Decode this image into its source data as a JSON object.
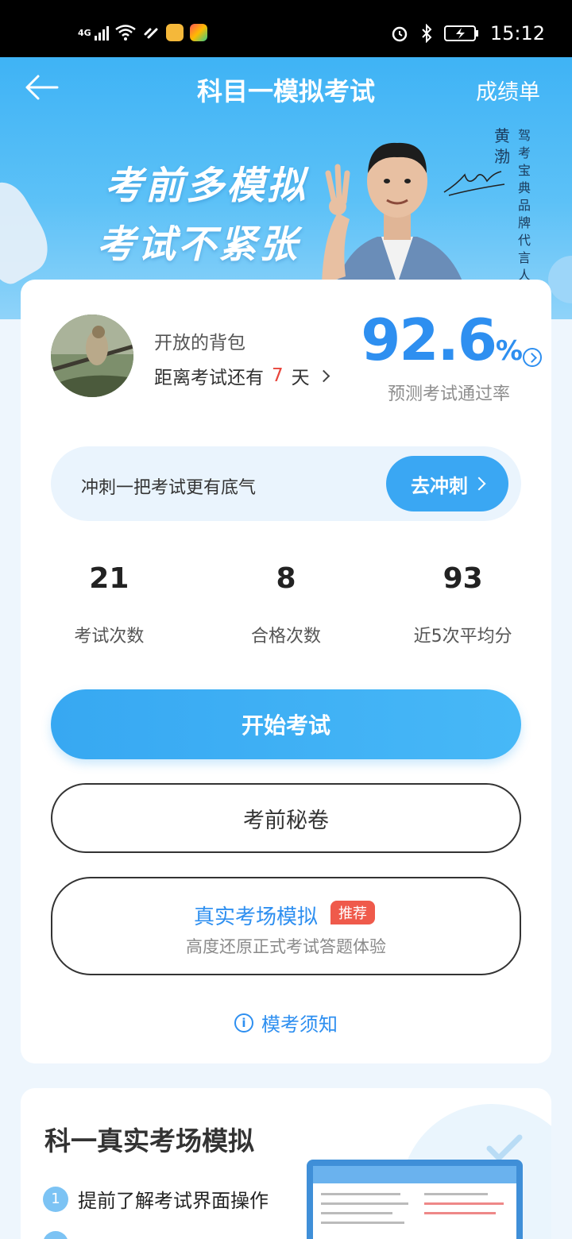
{
  "status_bar": {
    "network": "4G",
    "time": "15:12"
  },
  "header": {
    "title": "科目一模拟考试",
    "right_link": "成绩单"
  },
  "banner": {
    "slogan_line1": "考前多模拟",
    "slogan_line2": "考试不紧张",
    "spokesperson_name": "黄渤",
    "spokesperson_role": "驾考宝典品牌代言人"
  },
  "profile": {
    "username": "开放的背包",
    "countdown_prefix": "距离考试还有",
    "countdown_days": "7",
    "countdown_suffix": "天",
    "pass_rate": "92.6",
    "pass_rate_unit": "%",
    "pass_rate_caption": "预测考试通过率"
  },
  "sprint": {
    "text": "冲刺一把考试更有底气",
    "button": "去冲刺"
  },
  "stats": [
    {
      "value": "21",
      "label": "考试次数"
    },
    {
      "value": "8",
      "label": "合格次数"
    },
    {
      "value": "93",
      "label": "近5次平均分"
    }
  ],
  "actions": {
    "start": "开始考试",
    "secret": "考前秘卷",
    "real_title": "真实考场模拟",
    "real_tag": "推荐",
    "real_subtitle": "高度还原正式考试答题体验",
    "notice": "模考须知"
  },
  "section2": {
    "title": "科一真实考场模拟",
    "features": [
      {
        "num": "1",
        "text": "提前了解考试界面操作"
      }
    ]
  },
  "colors": {
    "accent": "#2e8ff0",
    "primary_button": "#37a8f2",
    "highlight": "#e8453c",
    "tag": "#ef5a4b"
  }
}
